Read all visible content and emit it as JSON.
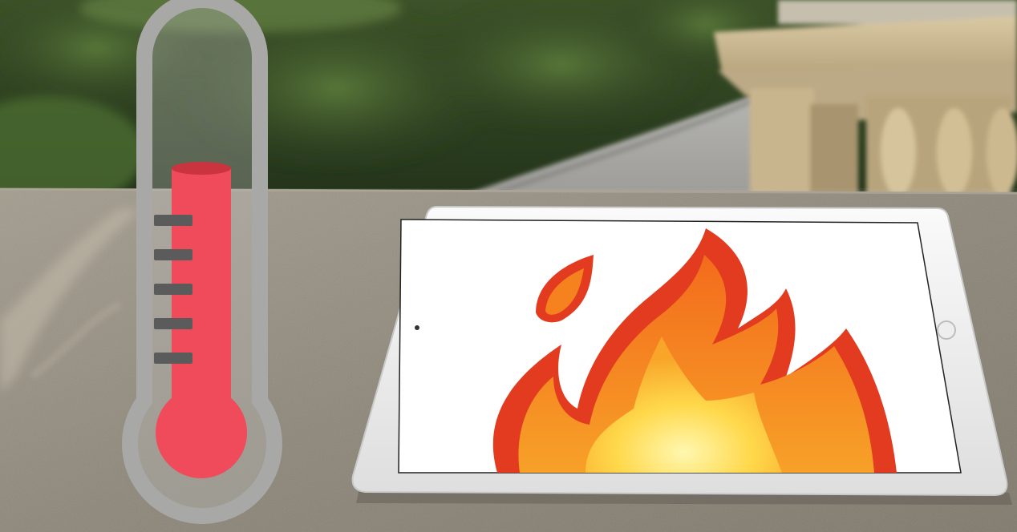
{
  "scene": {
    "description_icons": [
      "thermometer-icon",
      "tablet-device",
      "fire-icon"
    ],
    "colors": {
      "hedge_dark": "#2c3d20",
      "hedge_light": "#4e6a35",
      "path_gray": "#a9a9a5",
      "balustrade": "#cdbb94",
      "stone_ledge": "#8f897d",
      "thermometer_outline": "#a6a6a4",
      "mercury_red": "#ef4b5a",
      "tick_gray": "#5a5a5a",
      "tablet_bezel": "#f4f4f4",
      "flame_outer": "#e23b20",
      "flame_mid": "#f58a20",
      "flame_core": "#ffd84a"
    }
  }
}
